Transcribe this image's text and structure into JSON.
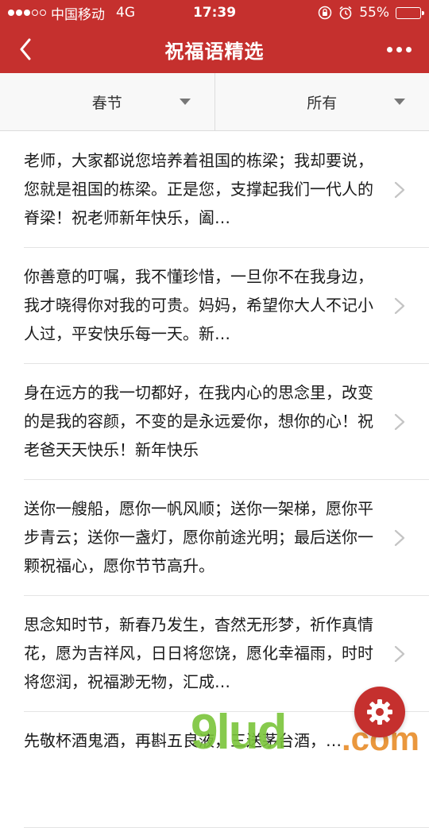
{
  "status_bar": {
    "carrier": "中国移动",
    "network": "4G",
    "time": "17:39",
    "battery": "55%",
    "battery_level": 0.55
  },
  "nav": {
    "title": "祝福语精选"
  },
  "filters": {
    "left": "春节",
    "right": "所有"
  },
  "messages": [
    "老师，大家都说您培养着祖国的栋梁；我却要说，您就是祖国的栋梁。正是您，支撑起我们一代人的脊梁！祝老师新年快乐，阖…",
    "你善意的叮嘱，我不懂珍惜，一旦你不在我身边，我才晓得你对我的可贵。妈妈，希望你大人不记小人过，平安快乐每一天。新…",
    "身在远方的我一切都好，在我内心的思念里，改变的是我的容颜，不变的是永远爱你，想你的心！祝老爸天天快乐！新年快乐",
    "送你一艘船，愿你一帆风顺；送你一架梯，愿你平步青云；送你一盏灯，愿你前途光明；最后送你一颗祝福心，愿你节节高升。",
    "思念知时节，新春乃发生，杳然无形梦，祈作真情花，愿为吉祥风，日日将您饶，愿化幸福雨，时时将您润，祝福渺无物，汇成…",
    "先敬杯酒鬼酒，再斟五良液，三送茅台酒，…"
  ],
  "watermark": {
    "brand": "9lud",
    "suffix": ".com"
  },
  "colors": {
    "brand_red": "#c5302e",
    "text": "#1a1a1a"
  }
}
